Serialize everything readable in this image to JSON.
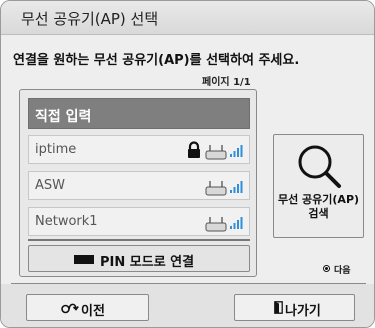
{
  "dialog": {
    "title": "무선 공유기(AP) 선택",
    "instruction": "연결을 원하는 무선 공유기(AP)를 선택하여 주세요.",
    "page_indicator": "페이지 1/1"
  },
  "ap_list": {
    "direct_input_label": "직접 입력",
    "networks": [
      {
        "ssid": "iptime",
        "secured": true,
        "icons": [
          "lock-icon",
          "router-icon",
          "signal-icon"
        ]
      },
      {
        "ssid": "ASW",
        "secured": false,
        "icons": [
          "router-icon",
          "signal-icon"
        ]
      },
      {
        "ssid": "Network1",
        "secured": false,
        "icons": [
          "router-icon",
          "signal-icon"
        ]
      }
    ],
    "pin_button_label": "PIN 모드로 연결"
  },
  "search": {
    "label_line1": "무선 공유기(AP)",
    "label_line2": "검색"
  },
  "hints": {
    "next_label": "다음"
  },
  "footer": {
    "back_label": "이전",
    "exit_label": "나가기"
  },
  "colors": {
    "signal": "#2f8fd8",
    "selected_item_bg": "#7f7f7f",
    "window_bg": "#eeeeee"
  }
}
